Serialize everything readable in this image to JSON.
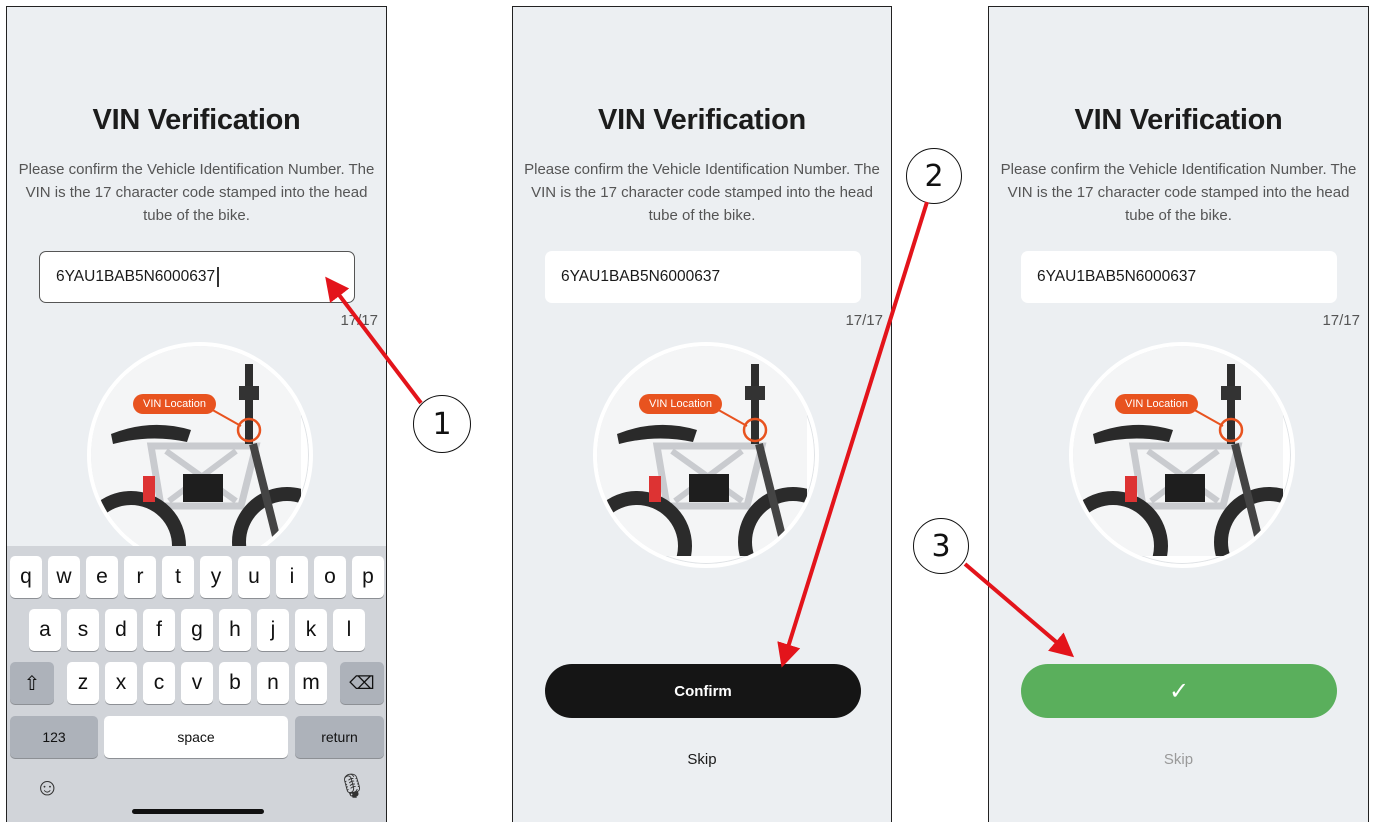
{
  "screens": [
    {
      "title": "VIN Verification",
      "description": "Please confirm the Vehicle Identification Number. The VIN is the 17 character code stamped into the head tube of the bike.",
      "vin_value": "6YAU1BAB5N6000637",
      "char_count": "17/17",
      "vin_location_label": "VIN Location",
      "keyboard": {
        "row1": [
          "q",
          "w",
          "e",
          "r",
          "t",
          "y",
          "u",
          "i",
          "o",
          "p"
        ],
        "row2": [
          "a",
          "s",
          "d",
          "f",
          "g",
          "h",
          "j",
          "k",
          "l"
        ],
        "row3": [
          "z",
          "x",
          "c",
          "v",
          "b",
          "n",
          "m"
        ],
        "numbers_label": "123",
        "space_label": "space",
        "return_label": "return"
      }
    },
    {
      "title": "VIN Verification",
      "description": "Please confirm the Vehicle Identification Number. The VIN is the 17 character code stamped into the head tube of the bike.",
      "vin_value": "6YAU1BAB5N6000637",
      "char_count": "17/17",
      "vin_location_label": "VIN Location",
      "confirm_label": "Confirm",
      "skip_label": "Skip"
    },
    {
      "title": "VIN Verification",
      "description": "Please confirm the Vehicle Identification Number. The VIN is the 17 character code stamped into the head tube of the bike.",
      "vin_value": "6YAU1BAB5N6000637",
      "char_count": "17/17",
      "vin_location_label": "VIN Location",
      "confirm_state": "✓",
      "skip_label": "Skip"
    }
  ],
  "steps": [
    "1",
    "2",
    "3"
  ],
  "colors": {
    "accent_orange": "#e8531f",
    "confirm_black": "#151515",
    "success_green": "#5aaf5c",
    "arrow_red": "#e3141b"
  },
  "icons": [
    "shift-icon",
    "backspace-icon",
    "emoji-icon",
    "microphone-icon",
    "checkmark-icon"
  ]
}
